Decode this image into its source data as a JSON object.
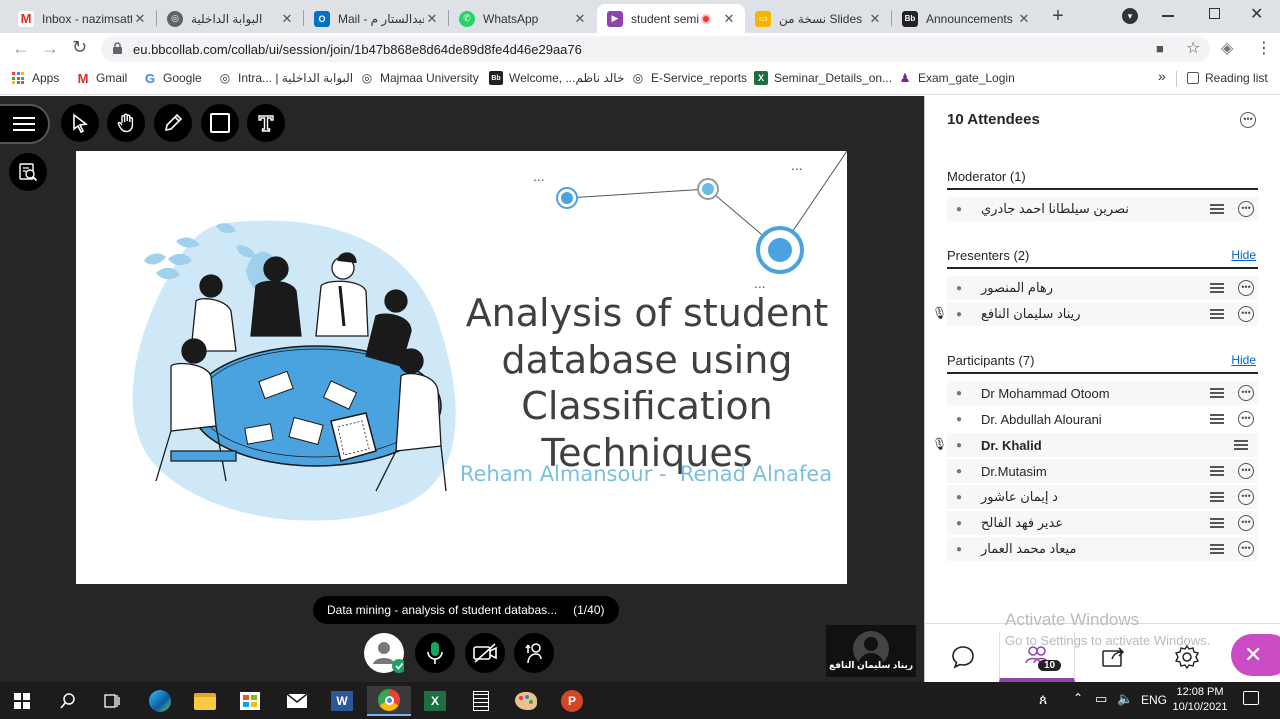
{
  "browser": {
    "tabs": [
      {
        "label": "Inbox - nazimsatt",
        "icon": "gmail-icon",
        "color": "#d93025",
        "glyph": "M"
      },
      {
        "label": "البوابة الداخلية",
        "icon": "globe-icon",
        "color": "#5f6368",
        "glyph": "◎"
      },
      {
        "label": "Mail - عبدالستار م",
        "icon": "outlook-icon",
        "color": "#0072c6",
        "glyph": "O"
      },
      {
        "label": "WhatsApp",
        "icon": "whatsapp-icon",
        "color": "#25d366",
        "glyph": "✆"
      },
      {
        "label": "student semi",
        "icon": "collaborate-icon",
        "color": "#8e44ad",
        "glyph": "▶"
      },
      {
        "label": "نسخة من Slides",
        "icon": "slides-icon",
        "color": "#f4b400",
        "glyph": "▭"
      },
      {
        "label": "Announcements",
        "icon": "blackboard-icon",
        "color": "#222",
        "glyph": "Bb"
      }
    ],
    "new_tab": "+",
    "url": "eu.bbcollab.com/collab/ui/session/join/1b47b868e8d64de89d8fe4d46e29aa76",
    "bookmarks": [
      {
        "label": "Apps",
        "icon": "apps-icon",
        "color": "#4285f4",
        "glyph": "⋮"
      },
      {
        "label": "Gmail",
        "icon": "gmail-icon",
        "color": "#d93025",
        "glyph": "M"
      },
      {
        "label": "Google",
        "icon": "google-icon",
        "color": "#4285f4",
        "glyph": "G"
      },
      {
        "label": "Intra... | البوابة الداخلية",
        "icon": "globe-icon",
        "color": "#5f6368",
        "glyph": "◎"
      },
      {
        "label": "Majmaa University",
        "icon": "globe-icon",
        "color": "#5f6368",
        "glyph": "◎"
      },
      {
        "label": "Welcome, ...خالد ناظم",
        "icon": "blackboard-icon",
        "color": "#222",
        "glyph": "Bb"
      },
      {
        "label": "E-Service_reports",
        "icon": "globe-icon",
        "color": "#5f6368",
        "glyph": "◎"
      },
      {
        "label": "Seminar_Details_on...",
        "icon": "excel-icon",
        "color": "#1d6f42",
        "glyph": "X"
      },
      {
        "label": "Exam_gate_Login",
        "icon": "exam-icon",
        "color": "#7b1fa2",
        "glyph": "♟"
      }
    ],
    "more": "»",
    "reading_list": "Reading list"
  },
  "session": {
    "slide": {
      "title": "Analysis of student database using Classification Techniques",
      "subtitle": "Reham Almansour -  Renad Alnafea",
      "dots": [
        "...",
        "...",
        "..."
      ]
    },
    "file_name": "Data mining - analysis of student databas...",
    "page_counter": "(1/40)",
    "camera_name": "ريناد سليمان النافع"
  },
  "attendees": {
    "title": "10 Attendees",
    "moderator": {
      "heading": "Moderator (1)",
      "members": [
        {
          "name": "نصرين سيلطانا احمد جادري",
          "bold": false,
          "mic": false
        }
      ]
    },
    "presenters": {
      "heading": "Presenters (2)",
      "hide": "Hide",
      "members": [
        {
          "name": "رهام المنصور",
          "bold": false,
          "mic": false
        },
        {
          "name": "ريناد سليمان النافع",
          "bold": false,
          "mic": true
        }
      ]
    },
    "participants": {
      "heading": "Participants (7)",
      "hide": "Hide",
      "members": [
        {
          "name": "Dr Mohammad Otoom",
          "bold": false,
          "mic": false
        },
        {
          "name": "Dr. Abdullah Alourani",
          "bold": false,
          "mic": false
        },
        {
          "name": "Dr. Khalid",
          "bold": true,
          "mic": true
        },
        {
          "name": "Dr.Mutasim",
          "bold": false,
          "mic": false
        },
        {
          "name": "د إيمان عاشور",
          "bold": false,
          "mic": false
        },
        {
          "name": "عدير فهد الفالح",
          "bold": false,
          "mic": false
        },
        {
          "name": "ميعاد محمد العمار",
          "bold": false,
          "mic": false
        }
      ]
    },
    "badge_count": "10"
  },
  "watermark": {
    "line1": "Activate Windows",
    "line2": "Go to Settings to activate Windows."
  },
  "taskbar": {
    "language": "ENG",
    "time": "12:08 PM",
    "date": "10/10/2021"
  },
  "colors": {
    "accent": "#8e44ad",
    "close_button": "#c94cc4",
    "slide_blue": "#4aa3df"
  }
}
